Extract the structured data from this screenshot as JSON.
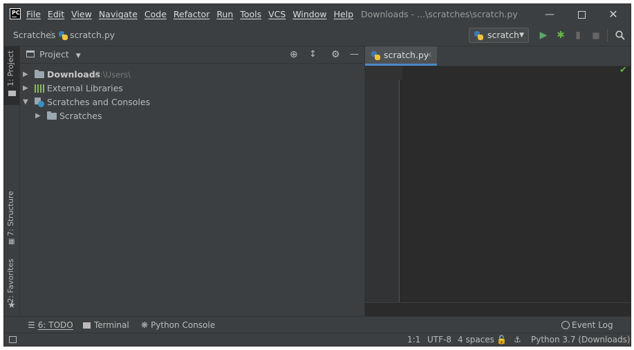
{
  "menu": [
    "File",
    "Edit",
    "View",
    "Navigate",
    "Code",
    "Refactor",
    "Run",
    "Tools",
    "VCS",
    "Window",
    "Help"
  ],
  "title": "Downloads - ...\\scratches\\scratch.py",
  "breadcrumb": {
    "root": "Scratches",
    "file": "scratch.py"
  },
  "run_config": {
    "label": "scratch"
  },
  "left_stripe": {
    "project": "1: Project",
    "structure": "7: Structure",
    "favorites": "2: Favorites"
  },
  "project_panel": {
    "title": "Project"
  },
  "tree": [
    {
      "label": "Downloads",
      "hint": "C:\\Users\\"
    },
    {
      "label": "External Libraries"
    },
    {
      "label": "Scratches and Consoles"
    },
    {
      "label": "Scratches"
    }
  ],
  "editor": {
    "tab": "scratch.py"
  },
  "bottom_tools": {
    "todo": "6: TODO",
    "terminal": "Terminal",
    "python_console": "Python Console",
    "event_log": "Event Log"
  },
  "status": {
    "position": "1:1",
    "encoding": "UTF-8",
    "indent": "4 spaces",
    "interpreter": "Python 3.7 (Downloads)"
  },
  "colors": {
    "run": "#59a869",
    "debug": "#62b543",
    "tab_underline": "#4a88c7"
  }
}
